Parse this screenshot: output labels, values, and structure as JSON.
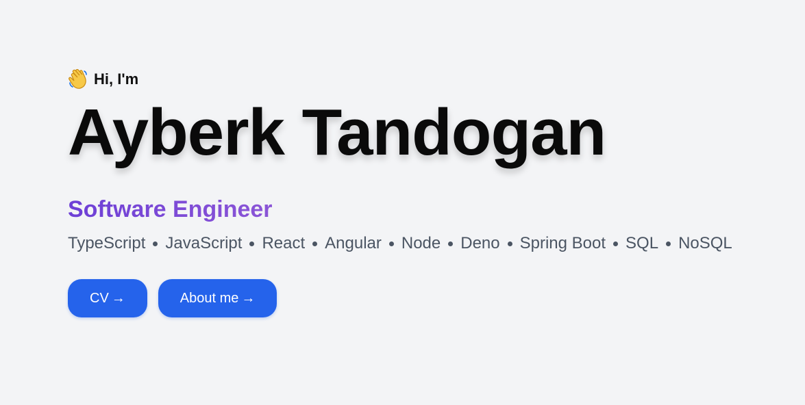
{
  "hero": {
    "greeting_icon": "waving-hand-icon",
    "greeting": "Hi, I'm",
    "name": "Ayberk Tandogan",
    "role": "Software Engineer",
    "skills": [
      "TypeScript",
      "JavaScript",
      "React",
      "Angular",
      "Node",
      "Deno",
      "Spring Boot",
      "SQL",
      "NoSQL"
    ]
  },
  "actions": {
    "cv_label": "CV",
    "about_label": "About me",
    "arrow": "→"
  },
  "colors": {
    "background": "#f3f4f6",
    "role_gradient_start": "#6d3fd6",
    "role_gradient_end": "#8b55d6",
    "button": "#2563eb",
    "skills_text": "#4b5563"
  }
}
